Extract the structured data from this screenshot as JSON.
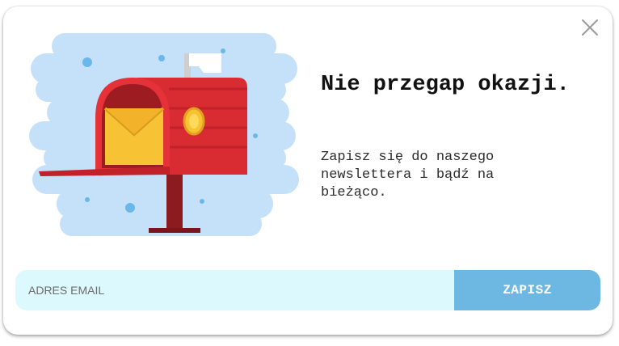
{
  "modal": {
    "headline": "Nie przegap okazji.",
    "subtext": "Zapisz się do naszego newslettera i bądź na bieżąco.",
    "close_icon": "close-icon"
  },
  "form": {
    "email_placeholder": "ADRES EMAIL",
    "email_value": "",
    "submit_label": "ZAPISZ"
  },
  "illustration": {
    "name": "mailbox-illustration",
    "colors": {
      "cloud": "#c4e1f9",
      "dots": "#6ab7ea",
      "mailbox_red": "#d92b32",
      "mailbox_dark": "#9c1c22",
      "envelope": "#f7c234",
      "flag": "#ffffff",
      "post": "#8b1b1e"
    }
  },
  "colors": {
    "accent": "#6db8e2",
    "input_bg": "#dcf9fd",
    "text": "#111111"
  }
}
